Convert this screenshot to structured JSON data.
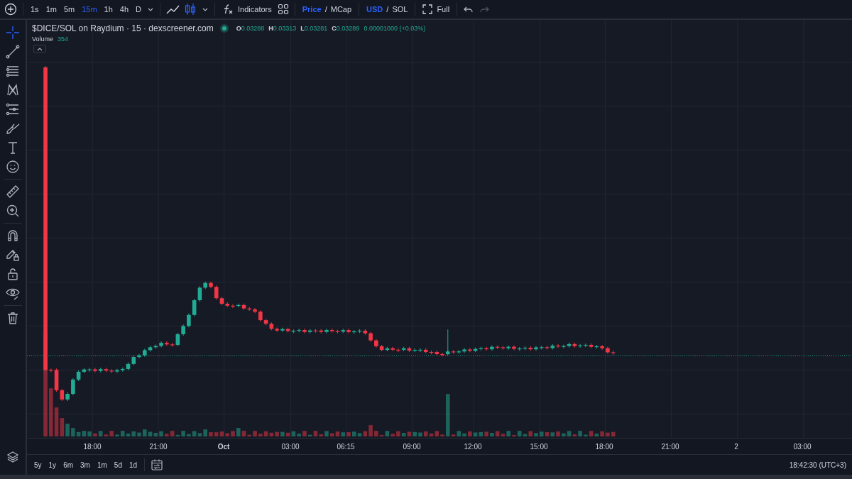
{
  "toolbar": {
    "intervals": [
      {
        "label": "1s",
        "selected": false
      },
      {
        "label": "1m",
        "selected": false
      },
      {
        "label": "5m",
        "selected": false
      },
      {
        "label": "15m",
        "selected": true
      },
      {
        "label": "1h",
        "selected": false
      },
      {
        "label": "4h",
        "selected": false
      },
      {
        "label": "D",
        "selected": false
      }
    ],
    "chart_types": [
      {
        "kind": "line",
        "selected": false
      },
      {
        "kind": "candles",
        "selected": true
      }
    ],
    "indicators": "Indicators",
    "value_mode": {
      "options": [
        {
          "label": "Price",
          "selected": true
        },
        {
          "label": "MCap",
          "selected": false
        }
      ],
      "separator": "/"
    },
    "currency": {
      "options": [
        {
          "label": "USD",
          "selected": true
        },
        {
          "label": "SOL",
          "selected": false
        }
      ],
      "separator": "/"
    },
    "fullscreen": "Full",
    "undo": {
      "disabled": false
    },
    "redo": {
      "disabled": true
    }
  },
  "left_toolbar": {
    "tool_groups": [
      [
        {
          "kind": "crosshair",
          "selected": true
        },
        {
          "kind": "trend-line",
          "selected": false
        },
        {
          "kind": "fib",
          "selected": false
        },
        {
          "kind": "pattern",
          "selected": false
        },
        {
          "kind": "projection",
          "selected": false
        },
        {
          "kind": "brush",
          "selected": false
        },
        {
          "kind": "text",
          "selected": false
        },
        {
          "kind": "emoji",
          "selected": false
        }
      ],
      [
        {
          "kind": "ruler",
          "selected": false
        },
        {
          "kind": "zoom",
          "selected": false
        }
      ],
      [
        {
          "kind": "magnet",
          "selected": false
        },
        {
          "kind": "lock-drawing",
          "selected": false
        },
        {
          "kind": "lock",
          "selected": false
        },
        {
          "kind": "eye",
          "selected": false
        }
      ],
      [
        {
          "kind": "trash",
          "selected": false
        }
      ]
    ]
  },
  "legend": {
    "title": "$DICE/SOL on Raydium · 15 · dexscreener.com",
    "ohlc": [
      {
        "key": "O",
        "value": "0.03288"
      },
      {
        "key": "H",
        "value": "0.03313"
      },
      {
        "key": "L",
        "value": "0.03281"
      },
      {
        "key": "C",
        "value": "0.03289"
      }
    ],
    "change": "0.00001000 (+0.03%)",
    "volume_label": "Volume",
    "volume_value": "354"
  },
  "time_axis": [
    {
      "label": "18:00",
      "bold": false
    },
    {
      "label": "21:00",
      "bold": false
    },
    {
      "label": "Oct",
      "bold": true
    },
    {
      "label": "03:00",
      "bold": false
    },
    {
      "label": "06:15",
      "bold": false
    },
    {
      "label": "09:00",
      "bold": false
    },
    {
      "label": "12:00",
      "bold": false
    },
    {
      "label": "15:00",
      "bold": false
    },
    {
      "label": "18:00",
      "bold": false
    },
    {
      "label": "21:00",
      "bold": false
    },
    {
      "label": "2",
      "bold": false
    },
    {
      "label": "03:00",
      "bold": false
    }
  ],
  "ranges": [
    "5y",
    "1y",
    "6m",
    "3m",
    "1m",
    "5d",
    "1d"
  ],
  "timestamp": "18:42:30 (UTC+3)"
}
